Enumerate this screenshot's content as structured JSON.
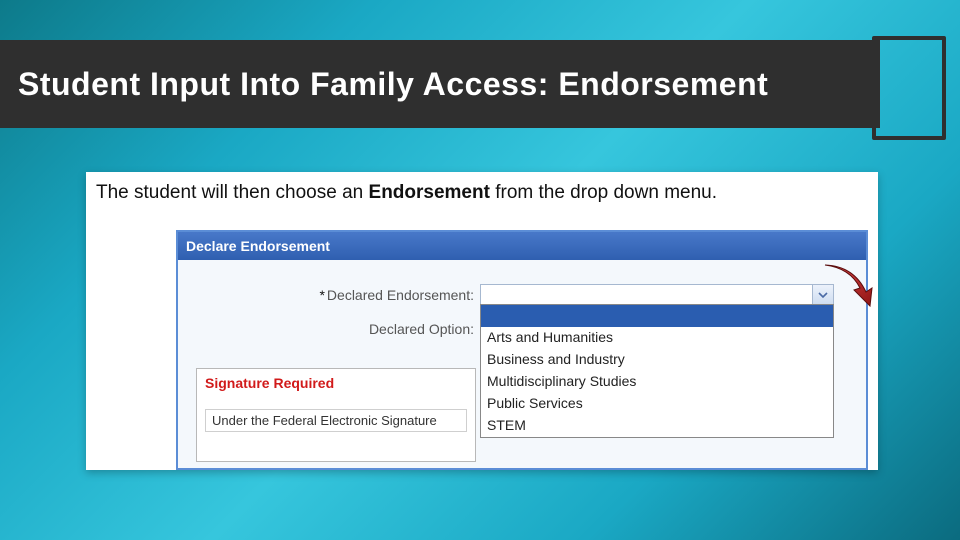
{
  "slide": {
    "title": "Student Input Into Family Access: Endorsement"
  },
  "instruction": {
    "prefix": "The student will then choose an ",
    "bold": "Endorsement",
    "suffix": " from the drop down menu."
  },
  "panel": {
    "header": "Declare Endorsement",
    "labels": {
      "declared_endorsement": "Declared Endorsement:",
      "declared_option": "Declared Option:"
    },
    "dropdown": {
      "value": "",
      "options": [
        "",
        "Arts and Humanities",
        "Business and Industry",
        "Multidisciplinary Studies",
        "Public Services",
        "STEM"
      ]
    },
    "signature": {
      "title": "Signature Required",
      "text": "Under the Federal Electronic Signature"
    }
  }
}
